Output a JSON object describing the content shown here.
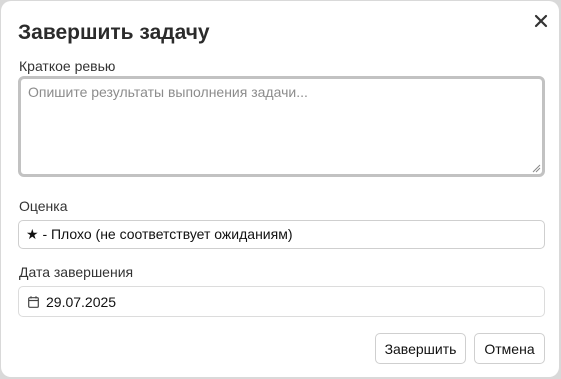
{
  "dialog": {
    "title": "Завершить задачу",
    "close_icon": "close-icon"
  },
  "review": {
    "label": "Краткое ревью",
    "value": "",
    "placeholder": "Опишите результаты выполнения задачи..."
  },
  "rating": {
    "label": "Оценка",
    "selected": "★ - Плохо (не соответствует ожиданиям)"
  },
  "completion_date": {
    "label": "Дата завершения",
    "value": "29.07.2025",
    "icon": "calendar-icon"
  },
  "actions": {
    "complete_label": "Завершить",
    "cancel_label": "Отмена"
  }
}
